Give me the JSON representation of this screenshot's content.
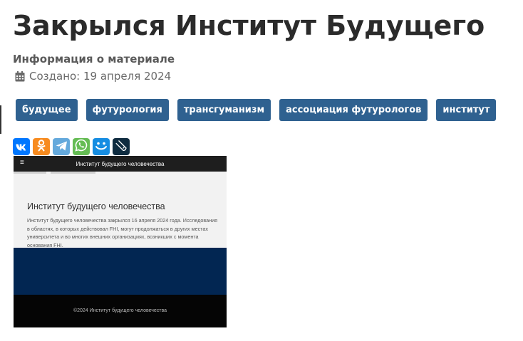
{
  "article": {
    "title": "Закрылся Институт Будущего",
    "info_label": "Информация о материале",
    "created": "Создано: 19 апреля 2024"
  },
  "tags": [
    "будущее",
    "футурология",
    "трансгуманизм",
    "ассоциация футурологов",
    "институт"
  ],
  "share_buttons": [
    {
      "icon": "vk-icon",
      "color": "#0077ff"
    },
    {
      "icon": "odnoklassniki-icon",
      "color": "#f78b1f"
    },
    {
      "icon": "telegram-icon",
      "color": "#64a9dc"
    },
    {
      "icon": "whatsapp-icon",
      "color": "#65bc54"
    },
    {
      "icon": "moimir-icon",
      "color": "#168de2"
    },
    {
      "icon": "livejournal-icon",
      "color": "#0f2c40"
    }
  ],
  "screenshot": {
    "header_title": "Институт будущего человечества",
    "heading": "Институт будущего человечества",
    "text": "Институт будущего человечества закрылся 16 апреля 2024 года. Исследования в областях, в которых действовал FHI, могут продолжаться в других местах университета и во многих внешних организациях, возникших с момента основания FHI.",
    "footer": "©2024 Институт будущего человечества"
  }
}
